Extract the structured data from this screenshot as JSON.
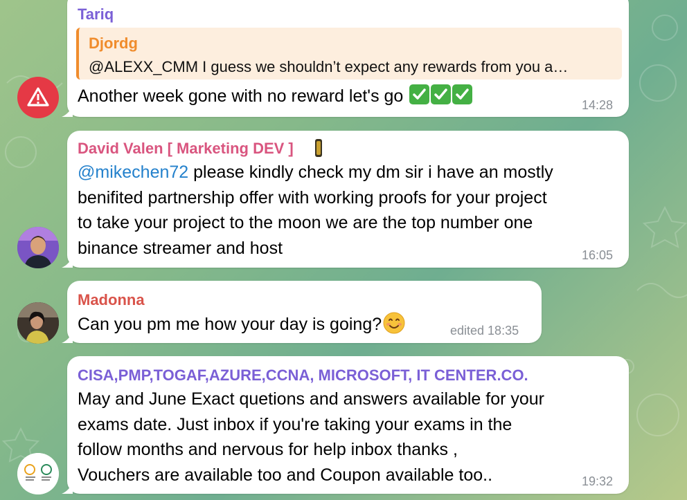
{
  "colors": {
    "tariq": "#7a5fd6",
    "djordg": "#f08c2c",
    "david": "#d9557f",
    "madonna": "#d9534a",
    "cisa": "#7a5fd6",
    "check_green": "#44b044",
    "quote_bg": "#fdeede"
  },
  "messages": [
    {
      "sender": "Tariq",
      "reply": {
        "name": "Djordg",
        "text": "@ALEXX_CMM I guess we shouldn’t expect any rewards from you a…"
      },
      "text": "Another week gone with no reward let's go",
      "emoji": [
        "white-check-mark",
        "white-check-mark",
        "white-check-mark"
      ],
      "time": "14:28",
      "avatar_icon": "warning-icon"
    },
    {
      "sender": "David Valen [ Marketing DEV ]",
      "mention": "@mikechen72",
      "lines": [
        " please kindly check  my dm sir i have an mostly",
        "benifited partnership offer with working proofs for your project",
        "to take your project to the moon we are the top number one",
        "binance streamer and host"
      ],
      "time": "16:05",
      "avatar_icon": "user-photo"
    },
    {
      "sender": "Madonna",
      "text": "Can you pm me how your day is going?",
      "emoji": [
        "smiling-face"
      ],
      "time": "edited 18:35",
      "avatar_icon": "user-photo"
    },
    {
      "sender": "CISA,PMP,TOGAF,AZURE,CCNA, MICROSOFT, IT CENTER.CO.",
      "lines": [
        "May and June Exact quetions and answers available for your",
        "exams date. Just inbox if you're taking your exams in the",
        "follow months and nervous for help inbox thanks ,",
        "Vouchers are available too and Coupon available too.."
      ],
      "time": "19:32",
      "avatar_icon": "logo-avatar"
    }
  ]
}
